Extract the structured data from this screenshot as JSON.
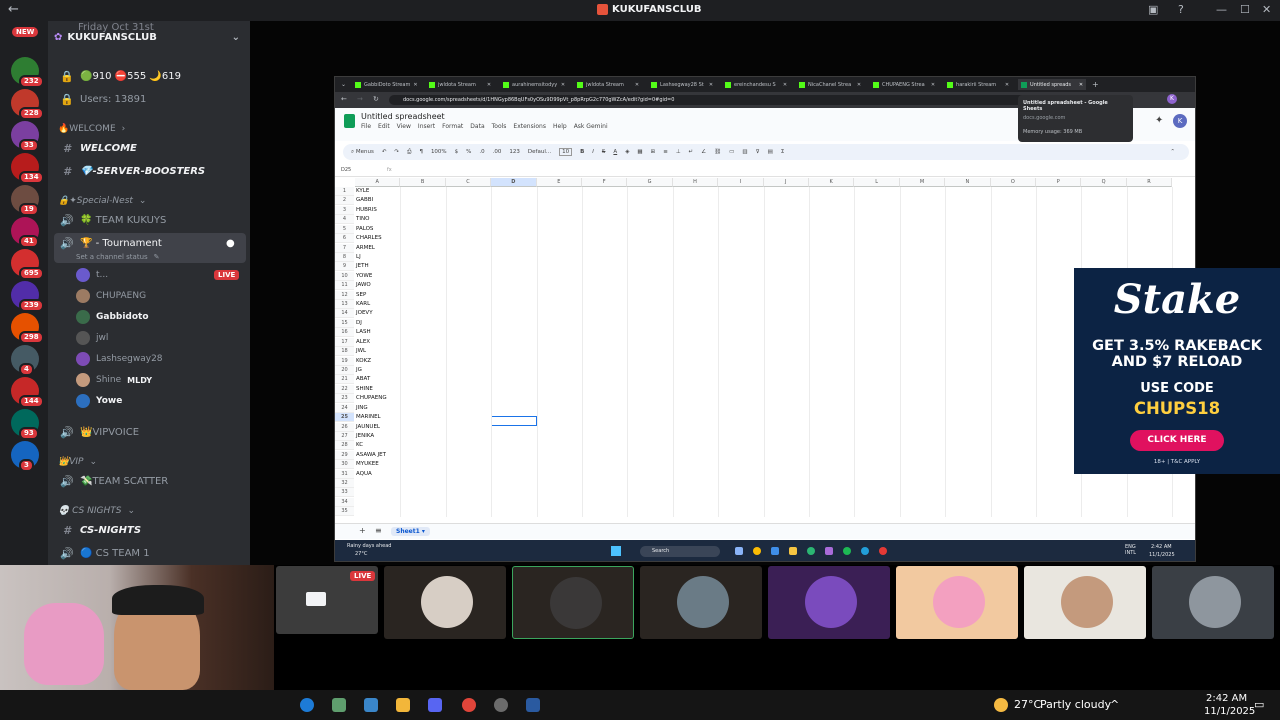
{
  "window": {
    "title": "KUKUFANSCLUB"
  },
  "rail": {
    "new_label": "NEW",
    "badges": [
      "232",
      "228",
      "33",
      "134",
      "19",
      "41",
      "695",
      "239",
      "298",
      "4",
      "144",
      "93",
      "3"
    ]
  },
  "server": {
    "name": "KUKUFANSCLUB",
    "event": "Friday Oct 31st",
    "stats": "🟢910 ⛔555 🌙619",
    "users": "Users: 13891"
  },
  "channels": [
    {
      "label": "🔥WELCOME",
      "kind": "category"
    },
    {
      "label": "WELCOME",
      "kind": "text-bold"
    },
    {
      "label": "💎-SERVER-BOOSTERS",
      "kind": "text-bold"
    },
    {
      "label": "🔒✦Special-Nest",
      "kind": "category"
    },
    {
      "label": "🍀 TEAM KUKUYS",
      "kind": "voice"
    },
    {
      "label": "🏆 - Tournament",
      "kind": "voice-selected"
    },
    {
      "label": "Set a channel status",
      "kind": "status"
    }
  ],
  "voice_users": [
    {
      "name": "t...",
      "live": "LIVE"
    },
    {
      "name": "CHUPAENG"
    },
    {
      "name": "Gabbidoto"
    },
    {
      "name": "jwl"
    },
    {
      "name": "Lashsegway28"
    },
    {
      "name": "Shine",
      "tag": "MLDY"
    },
    {
      "name": "Yowe"
    }
  ],
  "channels2": [
    {
      "label": "👑VIPVOICE",
      "kind": "voice"
    },
    {
      "label": "👑VIP",
      "kind": "category"
    },
    {
      "label": "💸TEAM SCATTER",
      "kind": "voice"
    },
    {
      "label": "💀 CS NIGHTS",
      "kind": "category"
    },
    {
      "label": "CS-NIGHTS",
      "kind": "text-bold"
    },
    {
      "label": "🔵 CS TEAM 1",
      "kind": "voice"
    }
  ],
  "browser": {
    "tabs": [
      "GabbiDoto Stream",
      "jwldota Stream",
      "aurahinemsitodyy",
      "jwldota Stream",
      "Lashsegway28 St",
      "ereinchandesu S",
      "NicaChanel Strea",
      "CHUPAENG Strea",
      "harakirii Stream",
      "Untitled spreads"
    ],
    "url": "docs.google.com/spreadsheets/d/1HNGyp86BqUFs0yOSu9D99pVt_p8pRrpG2c770gWZcA/edit?gid=0#gid=0",
    "tooltip_title": "Untitled spreadsheet - Google Sheets",
    "tooltip_host": "docs.google.com",
    "tooltip_mem": "Memory usage: 369 MB",
    "profile": "K"
  },
  "sheet": {
    "title": "Untitled spreadsheet",
    "menu": [
      "File",
      "Edit",
      "View",
      "Insert",
      "Format",
      "Data",
      "Tools",
      "Extensions",
      "Help",
      "Ask Gemini"
    ],
    "toolbar": {
      "menus": "Menus",
      "zoom": "100%",
      "currency": "$",
      "percent": "%",
      "decimals": ".0",
      "decimals2": ".00",
      "format123": "123",
      "font": "Defaul...",
      "size": "10"
    },
    "cell_ref": "D25",
    "fx": "fx",
    "columns": [
      "A",
      "B",
      "C",
      "D",
      "E",
      "F",
      "G",
      "H",
      "I",
      "J",
      "K",
      "L",
      "M",
      "N",
      "O",
      "P",
      "Q",
      "R"
    ],
    "rows": [
      "KYLE",
      "GABBI",
      "HUBRIS",
      "TINO",
      "PALOS",
      "CHARLES",
      "ARMEL",
      "LJ",
      "JETH",
      "YOWE",
      "JAWO",
      "SEP",
      "KARL",
      "JOEVY",
      "DJ",
      "LASH",
      "ALEX",
      "JWL",
      "KOKZ",
      "JG",
      "ABAT",
      "SHINE",
      "CHUPAENG",
      "JING",
      "MARINEL",
      "JAUNUEL",
      "JENIKA",
      "KC",
      "ASAWA JET",
      "MYUKEE",
      "AQUA",
      "",
      "",
      "",
      ""
    ],
    "sheet_tab": "Sheet1",
    "weather": "Rainy days ahead",
    "temp_small": "27°C",
    "search": "Search",
    "lang": "ENG INTL",
    "time_small": "2:42 AM",
    "date_small": "11/1/2025"
  },
  "ad": {
    "brand": "Stake",
    "line1": "GET 3.5% RAKEBACK",
    "line2": "AND $7 RELOAD",
    "line3": "USE CODE",
    "code": "CHUPS18",
    "button": "CLICK HERE",
    "fine": "18+ | T&C APPLY"
  },
  "stage": {
    "live": "LIVE"
  },
  "taskbar": {
    "temp": "27°C",
    "weather": "Partly cloudy",
    "time": "2:42 AM",
    "date": "11/1/2025"
  }
}
